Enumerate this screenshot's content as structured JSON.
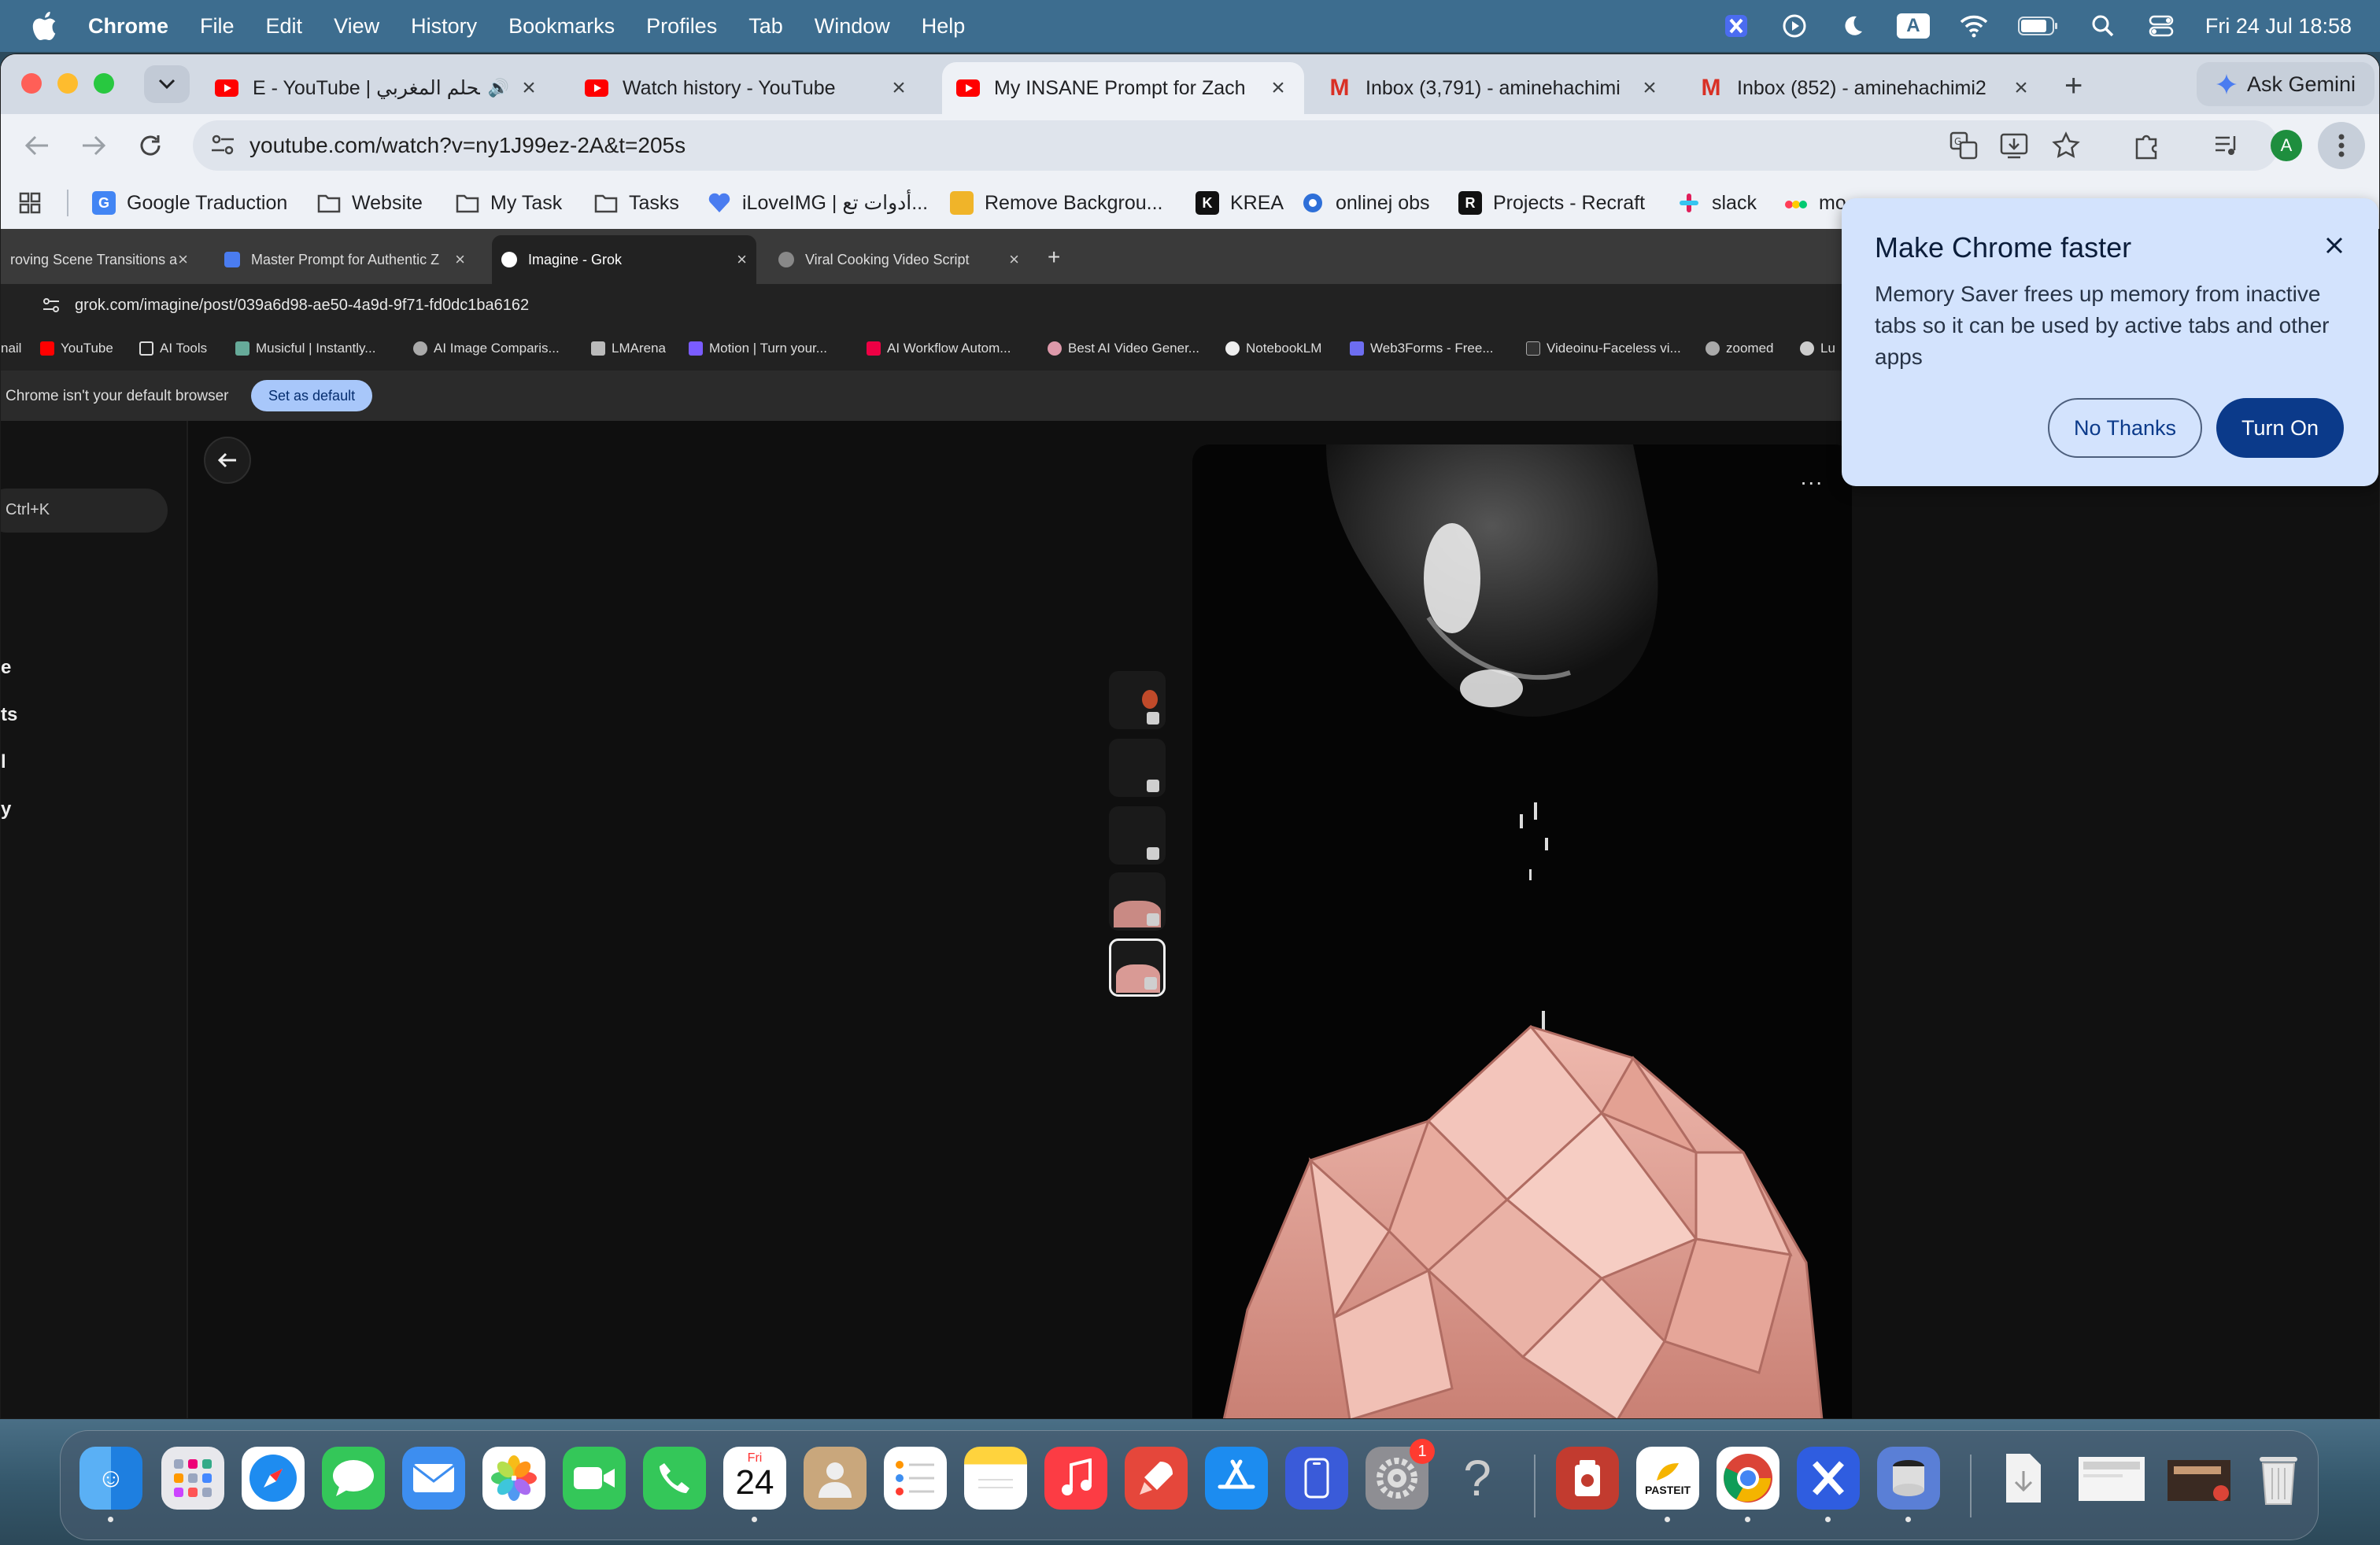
{
  "menubar": {
    "app": "Chrome",
    "items": [
      "File",
      "Edit",
      "View",
      "History",
      "Bookmarks",
      "Profiles",
      "Tab",
      "Window",
      "Help"
    ],
    "clock": "Fri 24 Jul  18:58",
    "input_source": "A"
  },
  "tabs": [
    {
      "title": "E - YouTube | الحلم المغربي",
      "icon": "youtube-icon"
    },
    {
      "title": "Watch history - YouTube",
      "icon": "youtube-icon"
    },
    {
      "title": "My INSANE Prompt for Zach",
      "icon": "youtube-icon"
    },
    {
      "title": "Inbox (3,791) - aminehachimi",
      "icon": "gmail-icon"
    },
    {
      "title": "Inbox (852) - aminehachimi2",
      "icon": "gmail-icon"
    }
  ],
  "ask_gemini": "Ask Gemini",
  "omnibox": {
    "url": "youtube.com/watch?v=ny1J99ez-2A&t=205s"
  },
  "profile_initial": "A",
  "bookmarks": [
    "Google Traduction",
    "Website",
    "My Task",
    "Tasks",
    "iLoveIMG | أدوات تع...",
    "Remove Backgrou...",
    "KREA",
    "onlinej obs",
    "Projects - Recraft",
    "slack",
    "mo"
  ],
  "video_frame": {
    "tabs": [
      {
        "title": "roving Scene Transitions an"
      },
      {
        "title": "Master Prompt for Authentic Z"
      },
      {
        "title": "Imagine - Grok"
      },
      {
        "title": "Viral Cooking Video Script"
      }
    ],
    "url": "grok.com/imagine/post/039a6d98-ae50-4a9d-9f71-fd0dc1ba6162",
    "bookmarks": [
      "nail",
      "YouTube",
      "AI Tools",
      "Musicful | Instantly...",
      "AI Image Comparis...",
      "LMArena",
      "Motion | Turn your...",
      "AI Workflow Autom...",
      "Best AI Video Gener...",
      "NotebookLM",
      "Web3Forms - Free...",
      "Videoinu-Faceless vi...",
      "zoomed",
      "Lu"
    ],
    "default_browser_msg": "Chrome isn't your default browser",
    "set_default": "Set as default",
    "search_hint": "Ctrl+K",
    "side_fragments": [
      "e",
      "ts",
      "l",
      "y"
    ],
    "more": "..."
  },
  "popup": {
    "title": "Make Chrome faster",
    "body": "Memory Saver frees up memory from inactive tabs so it can be used by active tabs and other apps",
    "no_thanks": "No Thanks",
    "turn_on": "Turn On"
  },
  "dock": {
    "calendar_day": "Fri",
    "calendar_date": "24",
    "settings_badge": "1",
    "pasteit": "PASTEIT"
  }
}
